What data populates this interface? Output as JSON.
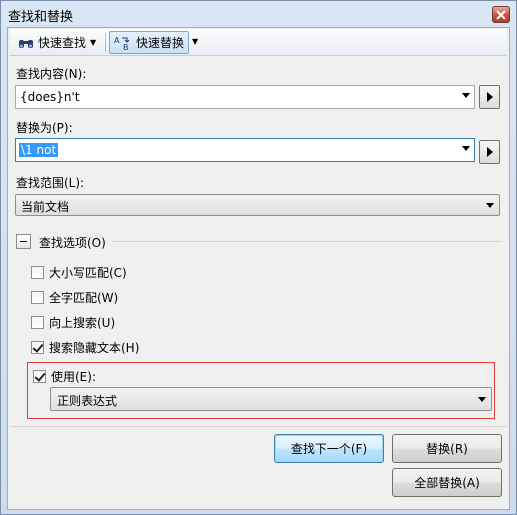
{
  "window": {
    "title": "查找和替换"
  },
  "toolbar": {
    "quick_find_label": "快速查找",
    "quick_replace_label": "快速替换"
  },
  "find": {
    "label": "查找内容(N):",
    "value": "{does}n't"
  },
  "replace": {
    "label": "替换为(P):",
    "value": "\\1 not"
  },
  "scope": {
    "label": "查找范围(L):",
    "value": "当前文档"
  },
  "options": {
    "header": "查找选项(O)",
    "items": [
      {
        "label": "大小写匹配(C)",
        "checked": false
      },
      {
        "label": "全字匹配(W)",
        "checked": false
      },
      {
        "label": "向上搜索(U)",
        "checked": false
      },
      {
        "label": "搜索隐藏文本(H)",
        "checked": true
      }
    ],
    "use": {
      "label": "使用(E):",
      "checked": true,
      "value": "正则表达式"
    }
  },
  "buttons": {
    "find_next": "查找下一个(F)",
    "replace": "替换(R)",
    "replace_all": "全部替换(A)"
  },
  "colors": {
    "highlight": "#d9433b",
    "selection": "#3399ff"
  }
}
